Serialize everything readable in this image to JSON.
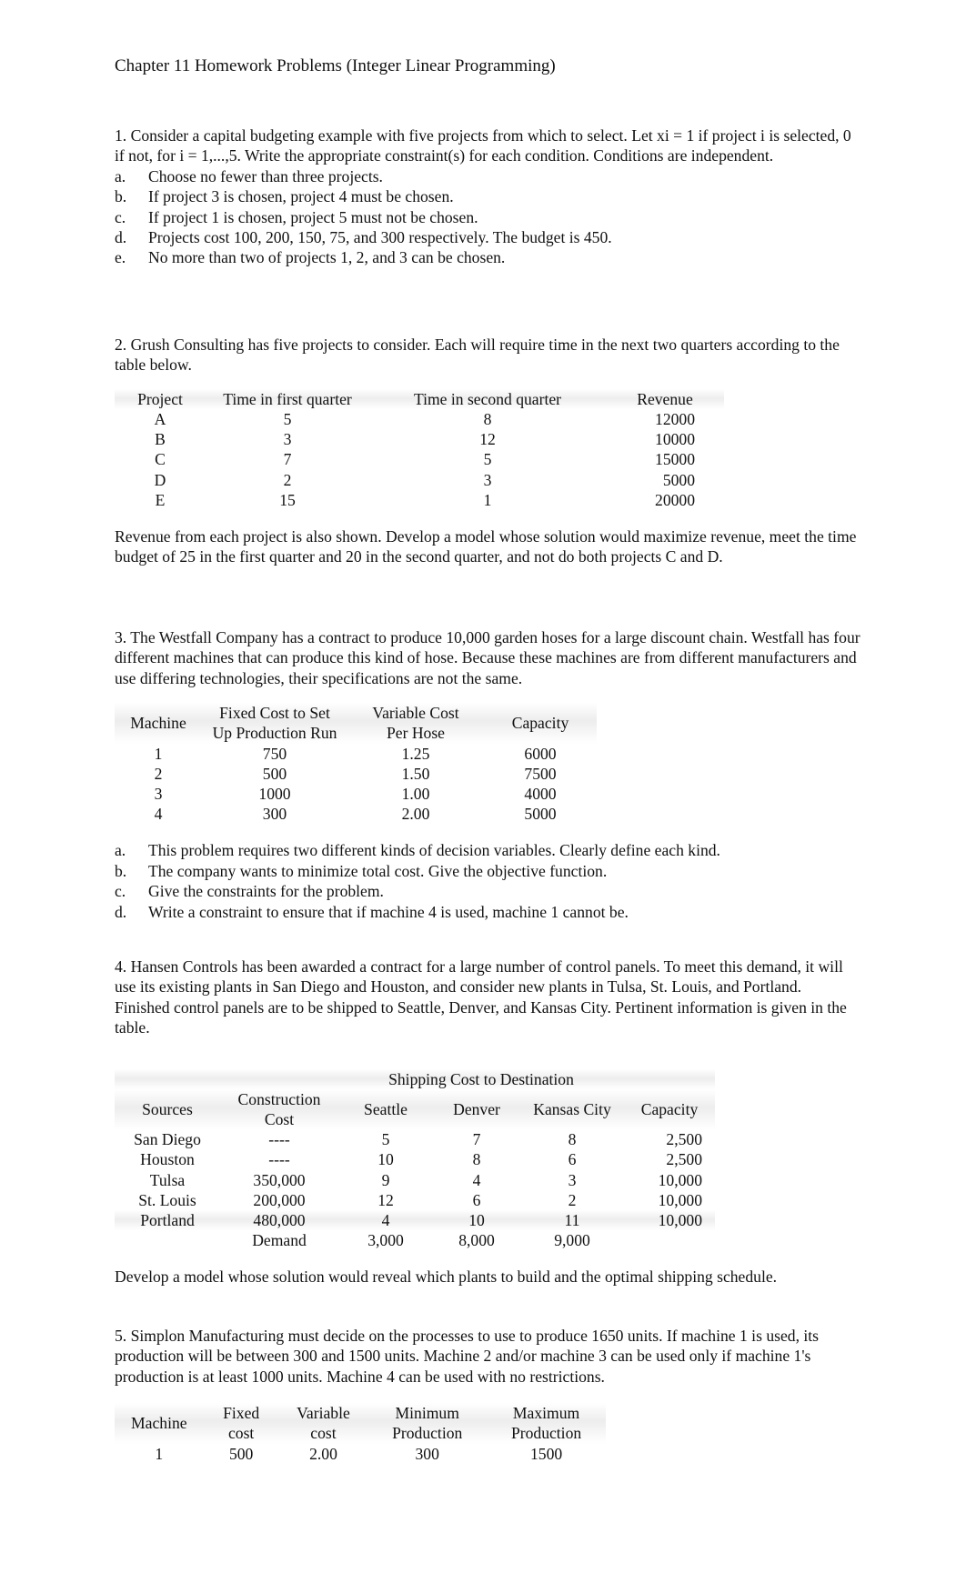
{
  "title": "Chapter 11 Homework Problems (Integer Linear Programming)",
  "p1": {
    "text": "1. Consider a capital budgeting example with five projects from which to select. Let xi = 1 if project i is selected, 0 if not, for i = 1,...,5. Write the appropriate constraint(s) for each condition. Conditions are independent.",
    "items": [
      {
        "label": "a.",
        "text": "Choose no fewer than three projects."
      },
      {
        "label": "b.",
        "text": "If project 3 is chosen, project 4 must be chosen."
      },
      {
        "label": "c.",
        "text": "If project 1 is chosen, project 5 must not be chosen."
      },
      {
        "label": "d.",
        "text": "Projects cost 100, 200, 150, 75, and 300 respectively. The budget is 450."
      },
      {
        "label": "e.",
        "text": "No more than two of projects 1, 2, and 3 can be chosen."
      }
    ]
  },
  "p2": {
    "text": "2. Grush Consulting has five projects to consider. Each will require time in the next two quarters according to the table below.",
    "headers": [
      "Project",
      "Time in first quarter",
      "Time in second quarter",
      "Revenue"
    ],
    "rows": [
      [
        "A",
        "5",
        "8",
        "12000"
      ],
      [
        "B",
        "3",
        "12",
        "10000"
      ],
      [
        "C",
        "7",
        "5",
        "15000"
      ],
      [
        "D",
        "2",
        "3",
        "5000"
      ],
      [
        "E",
        "15",
        "1",
        "20000"
      ]
    ],
    "after": "Revenue from each project is also shown. Develop a model whose solution would maximize revenue, meet the time budget of 25 in the first quarter and 20 in the second quarter, and not do both projects C and D."
  },
  "p3": {
    "text": "3. The Westfall Company has a contract to produce 10,000 garden hoses for a large discount chain. Westfall has four different machines that can produce this kind of hose. Because these machines are from different manufacturers and use differing technologies, their specifications are not the same.",
    "headers": [
      "Machine",
      "Fixed Cost to Set",
      "Up Production Run",
      "Variable Cost",
      "Per Hose",
      "Capacity"
    ],
    "rows": [
      [
        "1",
        "750",
        "1.25",
        "6000"
      ],
      [
        "2",
        "500",
        "1.50",
        "7500"
      ],
      [
        "3",
        "1000",
        "1.00",
        "4000"
      ],
      [
        "4",
        "300",
        "2.00",
        "5000"
      ]
    ],
    "items": [
      {
        "label": "a.",
        "text": "This problem requires two different kinds of decision variables. Clearly define each kind."
      },
      {
        "label": "b.",
        "text": "The company wants to minimize total cost. Give the objective function."
      },
      {
        "label": "c.",
        "text": "Give the constraints for the problem."
      },
      {
        "label": "d.",
        "text": "Write a constraint to ensure that if machine 4 is used, machine 1 cannot be."
      }
    ]
  },
  "p4": {
    "text": "4. Hansen Controls has been awarded a contract for a large number of control panels. To meet this demand, it will use its existing plants in San Diego and Houston, and consider new plants in Tulsa, St. Louis, and Portland. Finished control panels are to be shipped to Seattle, Denver, and Kansas City. Pertinent information is given in the table.",
    "group_header": "Shipping Cost to Destination",
    "headers": [
      "Sources",
      "Construction",
      "Cost",
      "Seattle",
      "Denver",
      "Kansas City",
      "Capacity"
    ],
    "rows": [
      [
        "San Diego",
        "----",
        "5",
        "7",
        "8",
        "2,500"
      ],
      [
        "Houston",
        "----",
        "10",
        "8",
        "6",
        "2,500"
      ],
      [
        "Tulsa",
        "350,000",
        "9",
        "4",
        "3",
        "10,000"
      ],
      [
        "St. Louis",
        "200,000",
        "12",
        "6",
        "2",
        "10,000"
      ],
      [
        "Portland",
        "480,000",
        "4",
        "10",
        "11",
        "10,000"
      ]
    ],
    "demand": [
      "Demand",
      "3,000",
      "8,000",
      "9,000"
    ],
    "after": "Develop a model whose solution would reveal which plants to build and the optimal shipping schedule."
  },
  "p5": {
    "text": "5. Simplon Manufacturing must decide on the processes to use to produce 1650 units. If machine 1 is used, its production will be between 300 and 1500 units. Machine 2 and/or machine 3 can be used only if machine 1's production is at least 1000 units. Machine 4 can be used with no restrictions.",
    "headers": [
      "Machine",
      "Fixed",
      "cost",
      "Variable",
      "cost",
      "Minimum",
      "Production",
      "Maximum",
      "Production"
    ],
    "rows": [
      [
        "1",
        "500",
        "2.00",
        "300",
        "1500"
      ]
    ]
  }
}
